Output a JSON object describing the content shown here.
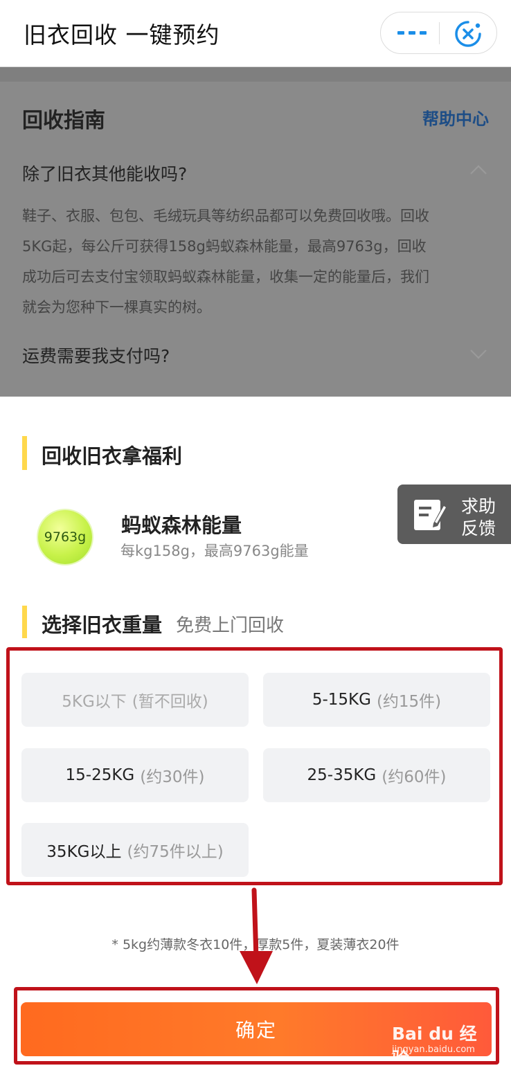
{
  "header": {
    "title": "旧衣回收 一键预约",
    "more_icon": "more-dots-icon",
    "close_icon": "mini-program-close-icon",
    "accent_color": "#1b8ee8"
  },
  "guide": {
    "title": "回收指南",
    "help_link": "帮助中心",
    "faq": [
      {
        "question": "除了旧衣其他能收吗?",
        "answer": "鞋子、衣服、包包、毛绒玩具等纺织品都可以免费回收哦。回收5KG起，每公斤可获得158g蚂蚁森林能量，最高9763g，回收成功后可去支付宝领取蚂蚁森林能量，收集一定的能量后，我们就会为您种下一棵真实的树。",
        "expanded": true
      },
      {
        "question": "运费需要我支付吗?",
        "expanded": false
      }
    ]
  },
  "benefit": {
    "title": "回收旧衣拿福利",
    "badge": "9763g",
    "name": "蚂蚁森林能量",
    "desc": "每kg158g，最高9763g能量"
  },
  "help_float": {
    "line1": "求助",
    "line2": "反馈"
  },
  "weight": {
    "title": "选择旧衣重量",
    "subtitle": "免费上门回收",
    "options": [
      {
        "label": "5KG以下",
        "hint": "(暂不回收)",
        "disabled": true
      },
      {
        "label": "5-15KG",
        "hint": "(约15件)"
      },
      {
        "label": "15-25KG",
        "hint": "(约30件)"
      },
      {
        "label": "25-35KG",
        "hint": "(约60件)"
      },
      {
        "label": "35KG以上",
        "hint": "(约75件以上)"
      }
    ],
    "note": "* 5kg约薄款冬衣10件，厚款5件，夏装薄衣20件"
  },
  "confirm_label": "确定",
  "watermark": {
    "logo": "Bai du 经验",
    "url": "jingyan.baidu.com"
  },
  "annotation_color": "#c0121a",
  "button_color": "#ff6a1f"
}
